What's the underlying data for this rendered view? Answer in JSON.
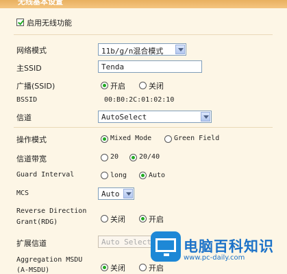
{
  "header": {
    "title": "无线基本设置"
  },
  "enable_wireless": {
    "label": "启用无线功能",
    "checked": true
  },
  "network_mode": {
    "label": "网络模式",
    "value": "11b/g/n混合模式"
  },
  "ssid": {
    "label": "主SSID",
    "value": "Tenda"
  },
  "broadcast": {
    "label": "广播(SSID)",
    "options": [
      "开启",
      "关闭"
    ],
    "selected": "开启"
  },
  "bssid": {
    "label": "BSSID",
    "value": "00:B0:2C:01:02:10"
  },
  "channel": {
    "label": "信道",
    "value": "AutoSelect"
  },
  "operating_mode": {
    "label": "操作模式",
    "options": [
      "Mixed Mode",
      "Green Field"
    ],
    "selected": "Mixed Mode"
  },
  "bandwidth": {
    "label": "信道带宽",
    "options": [
      "20",
      "20/40"
    ],
    "selected": "20/40"
  },
  "guard_interval": {
    "label": "Guard Interval",
    "options": [
      "long",
      "Auto"
    ],
    "selected": "Auto"
  },
  "mcs": {
    "label": "MCS",
    "value": "Auto"
  },
  "rdg": {
    "label_line1": "Reverse Direction",
    "label_line2": "Grant(RDG)",
    "options": [
      "关闭",
      "开启"
    ],
    "selected": "开启"
  },
  "ext_channel": {
    "label": "扩展信道",
    "value": "Auto Select"
  },
  "amsdu": {
    "label_line1": "Aggregation MSDU",
    "label_line2": "(A-MSDU)",
    "options": [
      "关闭",
      "开启"
    ],
    "selected": "关闭"
  },
  "watermark": {
    "title": "电脑百科知识",
    "url": "www.pc-daily.com"
  },
  "colors": {
    "header": "#e8b060",
    "background": "#fdf6e6",
    "radio_dot": "#22aa22",
    "watermark": "#1b72c8"
  }
}
